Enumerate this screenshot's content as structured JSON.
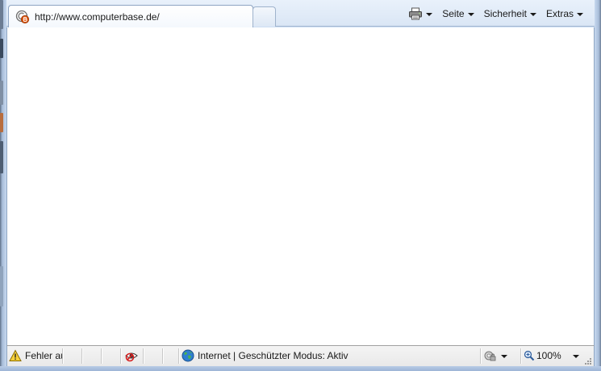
{
  "tab": {
    "title": "http://www.computerbase.de/",
    "favicon": "computerbase-favicon"
  },
  "cmdbar": {
    "print_icon": "printer-icon",
    "page_label": "Seite",
    "page_accesskey_index": 2,
    "security_label": "Sicherheit",
    "tools_label": "Extras"
  },
  "status": {
    "error_text": "Fehler au",
    "zone_text": "Internet | Geschützter Modus: Aktiv",
    "zoom_text": "100%"
  },
  "colors": {
    "frame": "#b9cfea",
    "content_bg": "#ffffff",
    "status_bg": "#efefef"
  }
}
